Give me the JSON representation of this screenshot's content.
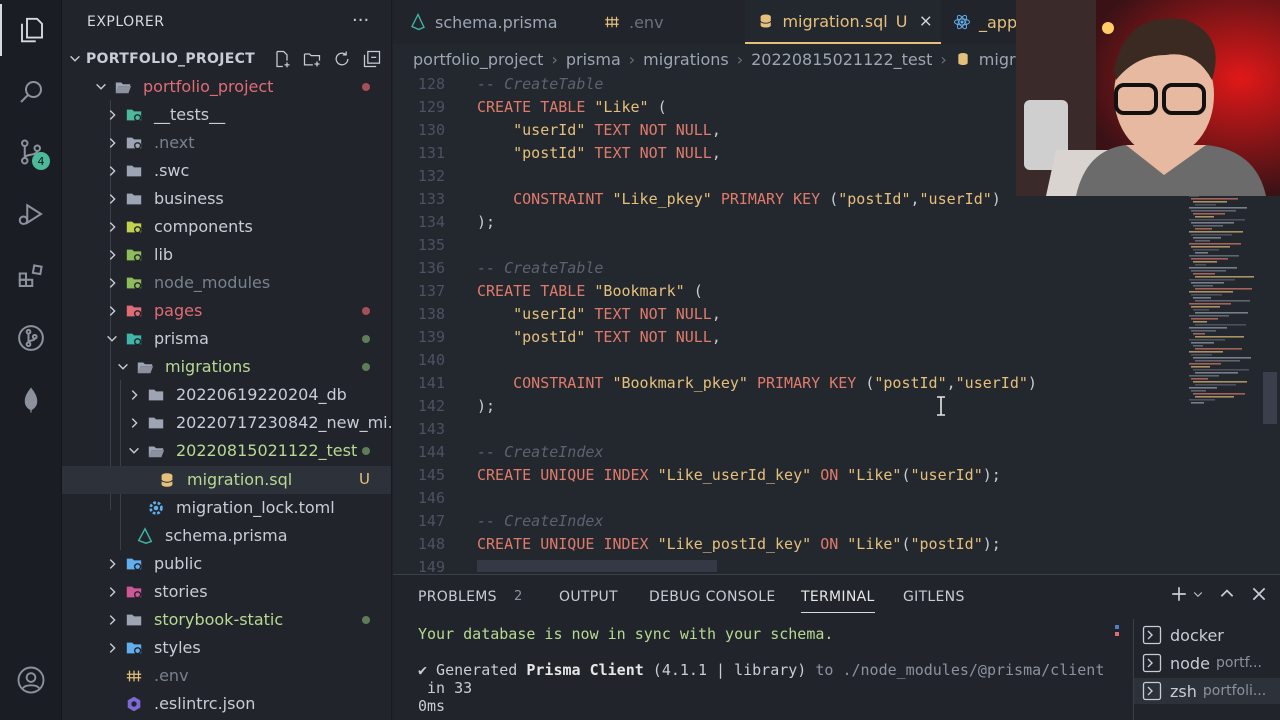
{
  "activity_bar": {
    "source_control_badge": "4"
  },
  "sidebar": {
    "title": "EXPLORER",
    "more": "···",
    "project_header": "PORTFOLIO_PROJECT",
    "tree": [
      {
        "name": "portfolio_project",
        "color": "#e06c75",
        "status": "dot",
        "status_color": "#a84e55",
        "expanded": true
      },
      {
        "name": "__tests__",
        "color": "#c8ccd4"
      },
      {
        "name": ".next",
        "color": "#7a818c"
      },
      {
        "name": ".swc",
        "color": "#c8ccd4"
      },
      {
        "name": "business",
        "color": "#c8ccd4"
      },
      {
        "name": "components",
        "color": "#c8ccd4"
      },
      {
        "name": "lib",
        "color": "#c8ccd4"
      },
      {
        "name": "node_modules",
        "color": "#7a818c"
      },
      {
        "name": "pages",
        "color": "#e06c75",
        "status": "dot",
        "status_color": "#a84e55"
      },
      {
        "name": "prisma",
        "color": "#c8ccd4",
        "status": "dot",
        "status_color": "#5f7c58",
        "expanded": true
      },
      {
        "name": "migrations",
        "color": "#b7d992",
        "status": "dot",
        "status_color": "#5f7c58",
        "expanded": true
      },
      {
        "name": "20220619220204_db",
        "color": "#c8ccd4"
      },
      {
        "name": "20220717230842_new_mi...",
        "color": "#c8ccd4"
      },
      {
        "name": "20220815021122_test",
        "color": "#b7d992",
        "status": "dot",
        "status_color": "#5f7c58",
        "expanded": true
      },
      {
        "name": "migration.sql",
        "color": "#b7d992",
        "status": "U"
      },
      {
        "name": "migration_lock.toml",
        "color": "#c8ccd4"
      },
      {
        "name": "schema.prisma",
        "color": "#c8ccd4"
      },
      {
        "name": "public",
        "color": "#c8ccd4"
      },
      {
        "name": "stories",
        "color": "#c8ccd4"
      },
      {
        "name": "storybook-static",
        "color": "#b7d992",
        "status": "dot",
        "status_color": "#5f7c58"
      },
      {
        "name": "styles",
        "color": "#c8ccd4"
      },
      {
        "name": ".env",
        "color": "#7a818c"
      },
      {
        "name": ".eslintrc.json",
        "color": "#c8ccd4"
      }
    ]
  },
  "tabs": [
    {
      "label": "schema.prisma",
      "icon": "prisma-icon"
    },
    {
      "label": ".env",
      "icon": "env-icon"
    },
    {
      "label": "migration.sql",
      "icon": "database-icon",
      "status": "U",
      "active": true
    },
    {
      "label": "_app",
      "icon": "react-icon"
    }
  ],
  "breadcrumb": [
    "portfolio_project",
    "prisma",
    "migrations",
    "20220815021122_test",
    "migrati"
  ],
  "code": {
    "lines": [
      {
        "n": "128",
        "t": "-- CreateTable"
      },
      {
        "n": "129",
        "t": "CREATE TABLE \"Like\" ("
      },
      {
        "n": "130",
        "t": "    \"userId\" TEXT NOT NULL,"
      },
      {
        "n": "131",
        "t": "    \"postId\" TEXT NOT NULL,"
      },
      {
        "n": "132",
        "t": ""
      },
      {
        "n": "133",
        "t": "    CONSTRAINT \"Like_pkey\" PRIMARY KEY (\"postId\",\"userId\")"
      },
      {
        "n": "134",
        "t": ");"
      },
      {
        "n": "135",
        "t": ""
      },
      {
        "n": "136",
        "t": "-- CreateTable"
      },
      {
        "n": "137",
        "t": "CREATE TABLE \"Bookmark\" ("
      },
      {
        "n": "138",
        "t": "    \"userId\" TEXT NOT NULL,"
      },
      {
        "n": "139",
        "t": "    \"postId\" TEXT NOT NULL,"
      },
      {
        "n": "140",
        "t": ""
      },
      {
        "n": "141",
        "t": "    CONSTRAINT \"Bookmark_pkey\" PRIMARY KEY (\"postId\",\"userId\")"
      },
      {
        "n": "142",
        "t": ");"
      },
      {
        "n": "143",
        "t": ""
      },
      {
        "n": "144",
        "t": "-- CreateIndex"
      },
      {
        "n": "145",
        "t": "CREATE UNIQUE INDEX \"Like_userId_key\" ON \"Like\"(\"userId\");"
      },
      {
        "n": "146",
        "t": ""
      },
      {
        "n": "147",
        "t": "-- CreateIndex"
      },
      {
        "n": "148",
        "t": "CREATE UNIQUE INDEX \"Like_postId_key\" ON \"Like\"(\"postId\");"
      },
      {
        "n": "149",
        "t": ""
      }
    ]
  },
  "panel": {
    "tabs": [
      {
        "label": "PROBLEMS",
        "count": "2"
      },
      {
        "label": "OUTPUT"
      },
      {
        "label": "DEBUG CONSOLE"
      },
      {
        "label": "TERMINAL",
        "active": true
      },
      {
        "label": "GITLENS"
      }
    ],
    "terminal": {
      "line1": "Your database is now in sync with your schema.",
      "line2_check": "✔ Generated ",
      "line2_bold": "Prisma Client",
      "line2_version": " (4.1.1 | library)",
      "line2_to": " to ",
      "line2_path": "./node_modules/@prisma/client",
      "line3": " in 33",
      "line4": "0ms"
    },
    "terminals": [
      {
        "name": "docker",
        "sub": ""
      },
      {
        "name": "node",
        "sub": "portf..."
      },
      {
        "name": "zsh",
        "sub": "portfoli...",
        "selected": true
      }
    ]
  }
}
